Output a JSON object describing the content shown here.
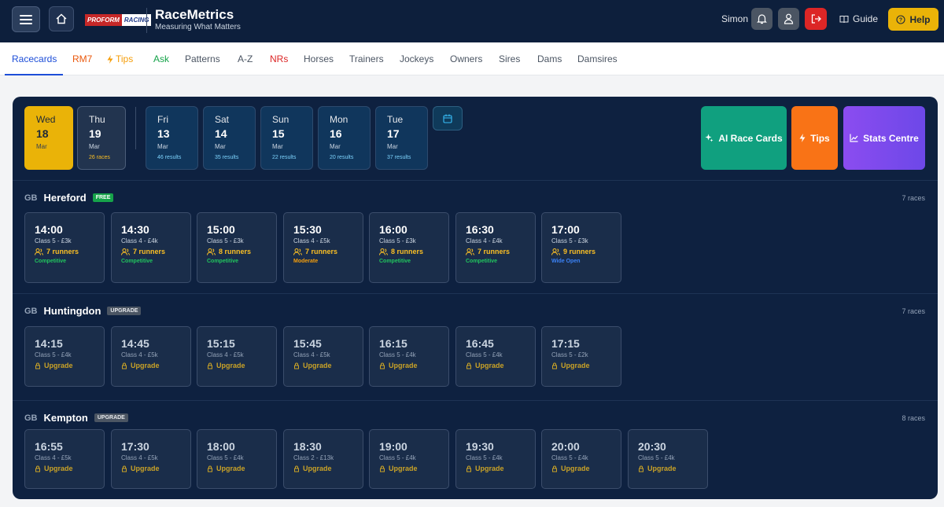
{
  "header": {
    "logo_text_1": "PROFORM",
    "logo_text_2": "RACING",
    "brand": "RaceMetrics",
    "tagline": "Measuring What Matters",
    "user": "Simon",
    "guide_label": "Guide",
    "help_label": "Help"
  },
  "nav": {
    "items": [
      {
        "label": "Racecards",
        "color": "#1d4ed8"
      },
      {
        "label": "RM7",
        "color": "#ea580c"
      },
      {
        "label": "Tips",
        "color": "#f59e0b"
      },
      {
        "label": "Ask",
        "color": "#16a34a"
      },
      {
        "label": "Patterns",
        "color": "#4b5563"
      },
      {
        "label": "A-Z",
        "color": "#4b5563"
      },
      {
        "label": "NRs",
        "color": "#dc2626"
      },
      {
        "label": "Horses",
        "color": "#4b5563"
      },
      {
        "label": "Trainers",
        "color": "#4b5563"
      },
      {
        "label": "Jockeys",
        "color": "#4b5563"
      },
      {
        "label": "Owners",
        "color": "#4b5563"
      },
      {
        "label": "Sires",
        "color": "#4b5563"
      },
      {
        "label": "Dams",
        "color": "#4b5563"
      },
      {
        "label": "Damsires",
        "color": "#4b5563"
      }
    ]
  },
  "days": [
    {
      "name": "Wed",
      "date": "18",
      "month": "Mar",
      "results": ""
    },
    {
      "name": "Thu",
      "date": "19",
      "month": "Mar",
      "results": "26 races"
    },
    {
      "name": "Fri",
      "date": "13",
      "month": "Mar",
      "results": "46 results"
    },
    {
      "name": "Sat",
      "date": "14",
      "month": "Mar",
      "results": "35 results"
    },
    {
      "name": "Sun",
      "date": "15",
      "month": "Mar",
      "results": "22 results"
    },
    {
      "name": "Mon",
      "date": "16",
      "month": "Mar",
      "results": "20 results"
    },
    {
      "name": "Tue",
      "date": "17",
      "month": "Mar",
      "results": "37 results"
    }
  ],
  "actions": {
    "ai_label": "AI Race Cards",
    "tips_label": "Tips",
    "stats_label": "Stats Centre"
  },
  "meetings": [
    {
      "country": "GB",
      "course": "Hereford",
      "badge": "FREE",
      "races_count": "7 races",
      "races": [
        {
          "time": "14:00",
          "cls": "Class 5 - £3k",
          "runners": "7 runners",
          "status": "Competitive",
          "status_color": "#22c55e"
        },
        {
          "time": "14:30",
          "cls": "Class 4 - £4k",
          "runners": "7 runners",
          "status": "Competitive",
          "status_color": "#22c55e"
        },
        {
          "time": "15:00",
          "cls": "Class 5 - £3k",
          "runners": "8 runners",
          "status": "Competitive",
          "status_color": "#22c55e"
        },
        {
          "time": "15:30",
          "cls": "Class 4 - £5k",
          "runners": "7 runners",
          "status": "Moderate",
          "status_color": "#f59e0b"
        },
        {
          "time": "16:00",
          "cls": "Class 5 - £3k",
          "runners": "8 runners",
          "status": "Competitive",
          "status_color": "#22c55e"
        },
        {
          "time": "16:30",
          "cls": "Class 4 - £4k",
          "runners": "7 runners",
          "status": "Competitive",
          "status_color": "#22c55e"
        },
        {
          "time": "17:00",
          "cls": "Class 5 - £3k",
          "runners": "9 runners",
          "status": "Wide Open",
          "status_color": "#3b82f6"
        }
      ]
    },
    {
      "country": "GB",
      "course": "Huntingdon",
      "badge": "UPGRADE",
      "races_count": "7 races",
      "races": [
        {
          "time": "14:15",
          "cls": "Class 5 - £4k",
          "upgrade": "Upgrade"
        },
        {
          "time": "14:45",
          "cls": "Class 4 - £5k",
          "upgrade": "Upgrade"
        },
        {
          "time": "15:15",
          "cls": "Class 4 - £5k",
          "upgrade": "Upgrade"
        },
        {
          "time": "15:45",
          "cls": "Class 4 - £5k",
          "upgrade": "Upgrade"
        },
        {
          "time": "16:15",
          "cls": "Class 5 - £4k",
          "upgrade": "Upgrade"
        },
        {
          "time": "16:45",
          "cls": "Class 5 - £4k",
          "upgrade": "Upgrade"
        },
        {
          "time": "17:15",
          "cls": "Class 5 - £2k",
          "upgrade": "Upgrade"
        }
      ]
    },
    {
      "country": "GB",
      "course": "Kempton",
      "badge": "UPGRADE",
      "races_count": "8 races",
      "races": [
        {
          "time": "16:55",
          "cls": "Class 4 - £5k",
          "upgrade": "Upgrade"
        },
        {
          "time": "17:30",
          "cls": "Class 4 - £5k",
          "upgrade": "Upgrade"
        },
        {
          "time": "18:00",
          "cls": "Class 5 - £4k",
          "upgrade": "Upgrade"
        },
        {
          "time": "18:30",
          "cls": "Class 2 - £13k",
          "upgrade": "Upgrade"
        },
        {
          "time": "19:00",
          "cls": "Class 5 - £4k",
          "upgrade": "Upgrade"
        },
        {
          "time": "19:30",
          "cls": "Class 5 - £4k",
          "upgrade": "Upgrade"
        },
        {
          "time": "20:00",
          "cls": "Class 5 - £4k",
          "upgrade": "Upgrade"
        },
        {
          "time": "20:30",
          "cls": "Class 5 - £4k",
          "upgrade": "Upgrade"
        }
      ]
    }
  ]
}
